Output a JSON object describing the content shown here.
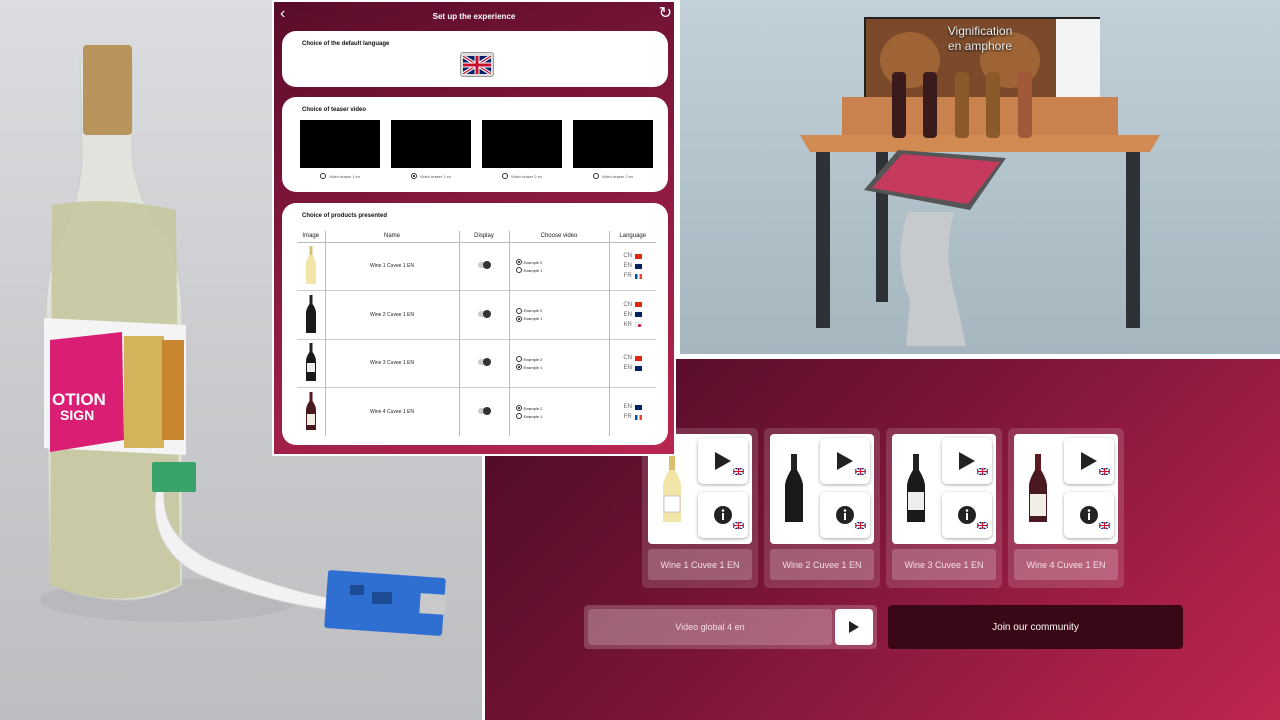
{
  "settings": {
    "title": "Set up the experience",
    "back_icon": "chevron-left-icon",
    "refresh_icon": "refresh-icon",
    "language_card": {
      "title": "Choice of the default language",
      "selected_flag": "uk-flag"
    },
    "teaser_card": {
      "title": "Choice of teaser video",
      "videos": [
        {
          "label": "Video teaser 1 en",
          "selected": false
        },
        {
          "label": "Video teaser 1 en",
          "selected": true
        },
        {
          "label": "Video teaser 2 en",
          "selected": false
        },
        {
          "label": "Video teaser 2 en",
          "selected": false
        }
      ]
    },
    "products_card": {
      "title": "Choice of products presented",
      "columns": [
        "Image",
        "Name",
        "Display",
        "Choose video",
        "Language"
      ],
      "rows": [
        {
          "name": "Wine 1 Cuvee 1 EN",
          "bottle": "white",
          "video_options": [
            "Example 2",
            "Example 1"
          ],
          "video_selected": 0,
          "languages": [
            "CN",
            "EN",
            "FR"
          ]
        },
        {
          "name": "Wine 2 Cuvee 1 EN",
          "bottle": "dark",
          "video_options": [
            "Example 2",
            "Example 1"
          ],
          "video_selected": 1,
          "languages": [
            "CN",
            "EN",
            "KR"
          ]
        },
        {
          "name": "Wine 3 Cuvee 1 EN",
          "bottle": "dark",
          "video_options": [
            "Example 2",
            "Example 1"
          ],
          "video_selected": 1,
          "languages": [
            "CN",
            "EN"
          ]
        },
        {
          "name": "Wine 4 Cuvee 1 EN",
          "bottle": "rose",
          "video_options": [
            "Example 2",
            "Example 1"
          ],
          "video_selected": 0,
          "languages": [
            "EN",
            "FR"
          ]
        }
      ]
    }
  },
  "render": {
    "screen_title_line1": "Vignification",
    "screen_title_line2": "en amphore"
  },
  "wine_app": {
    "tiles": [
      {
        "name": "Wine 1 Cuvee 1 EN",
        "bottle": "white"
      },
      {
        "name": "Wine 2 Cuvee 1 EN",
        "bottle": "dark"
      },
      {
        "name": "Wine 3 Cuvee 1 EN",
        "bottle": "dark"
      },
      {
        "name": "Wine 4 Cuvee 1 EN",
        "bottle": "rose"
      }
    ],
    "global_video_label": "Video global 4 en",
    "join_label": "Join our community"
  },
  "photo": {
    "label_text_line1": "OTION",
    "label_text_line2": "SIGN"
  },
  "colors": {
    "brand_dark": "#4a0a25",
    "brand_mid": "#7a1538",
    "brand_light": "#c0264f",
    "join_button": "#3a0716"
  }
}
